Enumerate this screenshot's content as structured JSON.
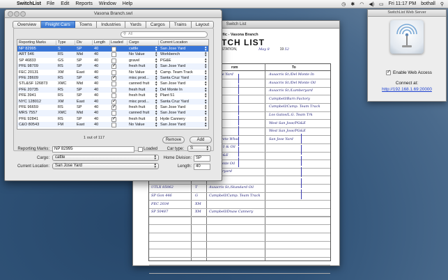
{
  "menubar": {
    "app_name": "SwitchList",
    "menus": [
      "File",
      "Edit",
      "Reports",
      "Window",
      "Help"
    ],
    "clock": "Fri 11:17 PM",
    "user": "bothall"
  },
  "switchlist_window": {
    "title": "Switch List",
    "header_line": "ific - Vasona Branch",
    "heading": "TCH LIST",
    "station_label": "STATION,",
    "date_value": "May 8",
    "year_label": "19",
    "year_value": "52",
    "col_from": "rom",
    "col_to": "To",
    "rows": [
      {
        "car": "",
        "type": "",
        "from": "San Jose Yard",
        "to": "Axsacris St./Del Monte In"
      },
      {
        "car": "",
        "type": "",
        "from": "",
        "to": "Axsacris St./Del Monte Oil"
      },
      {
        "car": "",
        "type": "",
        "from": "",
        "to": "Axsacris St./Lumberyard"
      },
      {
        "car": "",
        "type": "",
        "from": "",
        "to": "Campbell/Barn Factory"
      },
      {
        "car": "",
        "type": "",
        "from": "",
        "to": "Campbell/Camp. Team Track"
      },
      {
        "car": "",
        "type": "",
        "from": "",
        "to": "Los Gatos/L.G. Team Trk"
      },
      {
        "car": "",
        "type": "",
        "from": "",
        "to": "West San Jose/PG&E"
      },
      {
        "car": "",
        "type": "",
        "from": "",
        "to": "West San Jose/PG&E"
      },
      {
        "car": "",
        "type": "",
        "from": "e/Concrete Whse",
        "to": "San Jose Yard"
      },
      {
        "car": "",
        "type": "",
        "from": "/Plant 51 & Oil",
        "to": ""
      },
      {
        "car": "",
        "type": "",
        "from": "Jose/PG&E",
        "to": ""
      },
      {
        "car": "",
        "type": "",
        "from": "/Del Monte Oil",
        "to": ""
      },
      {
        "car": "",
        "type": "",
        "from": "/Lumberyard",
        "to": ""
      },
      {
        "car": "SP 8450",
        "type": "RS",
        "from": "",
        "to": ""
      },
      {
        "car": "UTLX 85062",
        "type": "T",
        "from": "Axsacris St./Standard Oil",
        "to": ""
      },
      {
        "car": "SP Gon 446",
        "type": "G",
        "from": "Campbell/Camp. Team Track",
        "to": ""
      },
      {
        "car": "FEC 2034",
        "type": "XM",
        "from": "",
        "to": ""
      },
      {
        "car": "SP 50487",
        "type": "XM",
        "from": "Campbell/Dnaw Cannery",
        "to": ""
      }
    ]
  },
  "main_window": {
    "title": "Vasona Branch.swl",
    "tabs": [
      "Overview",
      "Freight Cars",
      "Towns",
      "Industries",
      "Yards",
      "Cargos",
      "Trains",
      "Layout"
    ],
    "active_tab": "Freight Cars",
    "search_placeholder": "All",
    "columns": [
      "Reporting Marks",
      "Type",
      "Div",
      "Length",
      "Loaded",
      "Cargo",
      "Current Location"
    ],
    "cars": [
      {
        "marks": "NP 82995",
        "type": "S",
        "div": "SP",
        "length": "40",
        "loaded": false,
        "cargo": "cattle",
        "location": "San Jose Yard"
      },
      {
        "marks": "ART 546",
        "type": "RS",
        "div": "Mid",
        "length": "40",
        "loaded": false,
        "cargo": "No Value",
        "location": "Workbench"
      },
      {
        "marks": "SP 46833",
        "type": "GS",
        "div": "SP",
        "length": "40",
        "loaded": false,
        "cargo": "gravel",
        "location": "PG&E"
      },
      {
        "marks": "PFE 98709",
        "type": "RS",
        "div": "SP",
        "length": "40",
        "loaded": true,
        "cargo": "fresh fruit",
        "location": "San Jose Yard"
      },
      {
        "marks": "FEC 20131",
        "type": "XM",
        "div": "East",
        "length": "40",
        "loaded": false,
        "cargo": "No Value",
        "location": "Camp. Team Track"
      },
      {
        "marks": "PFE 28609",
        "type": "RS",
        "div": "SP",
        "length": "40",
        "loaded": true,
        "cargo": "misc prod...",
        "location": "Santa Cruz Yard"
      },
      {
        "marks": "STL&SF 126873",
        "type": "XMC",
        "div": "Mid",
        "length": "40",
        "loaded": false,
        "cargo": "canned fruit",
        "location": "San Jose Yard"
      },
      {
        "marks": "PFE 20735",
        "type": "RS",
        "div": "SP",
        "length": "40",
        "loaded": false,
        "cargo": "fresh fruit",
        "location": "Del Monte In"
      },
      {
        "marks": "PFE 3941",
        "type": "RS",
        "div": "SP",
        "length": "40",
        "loaded": false,
        "cargo": "fresh fruit",
        "location": "Plant 51"
      },
      {
        "marks": "NYC 128012",
        "type": "XM",
        "div": "East",
        "length": "40",
        "loaded": true,
        "cargo": "misc prod...",
        "location": "Santa Cruz Yard"
      },
      {
        "marks": "PFE 96659",
        "type": "RS",
        "div": "SP",
        "length": "40",
        "loaded": true,
        "cargo": "fresh fruit",
        "location": "San Jose Yard"
      },
      {
        "marks": "MRS 7557",
        "type": "XMC",
        "div": "Mid",
        "length": "40",
        "loaded": false,
        "cargo": "canned fruit",
        "location": "San Jose Yard"
      },
      {
        "marks": "PFE 92841",
        "type": "RS",
        "div": "SP",
        "length": "40",
        "loaded": true,
        "cargo": "fresh fruit",
        "location": "Hyde Cannery"
      },
      {
        "marks": "C&O 80543",
        "type": "FM",
        "div": "East",
        "length": "40",
        "loaded": false,
        "cargo": "No Value",
        "location": "San Jose Yard"
      }
    ],
    "count_text": "1 out of 117",
    "remove_label": "Remove",
    "add_label": "Add",
    "form": {
      "marks_label": "Reporting Marks:",
      "marks_value": "NP 82995",
      "loaded_label": "Loaded",
      "cartype_label": "Car type:",
      "cartype_value": "S",
      "cargo_label": "Cargo:",
      "cargo_value": "cattle",
      "home_label": "Home Division:",
      "home_value": "SP",
      "location_label": "Current Location:",
      "location_value": "San Jose Yard",
      "length_label": "Length:",
      "length_value": "40"
    }
  },
  "web_window": {
    "title": "SwitchList Web Server",
    "enable_label": "Enable Web Access",
    "enable_checked": true,
    "connect_label": "Connect at:",
    "url": "http://192.168.1.69:20000"
  }
}
